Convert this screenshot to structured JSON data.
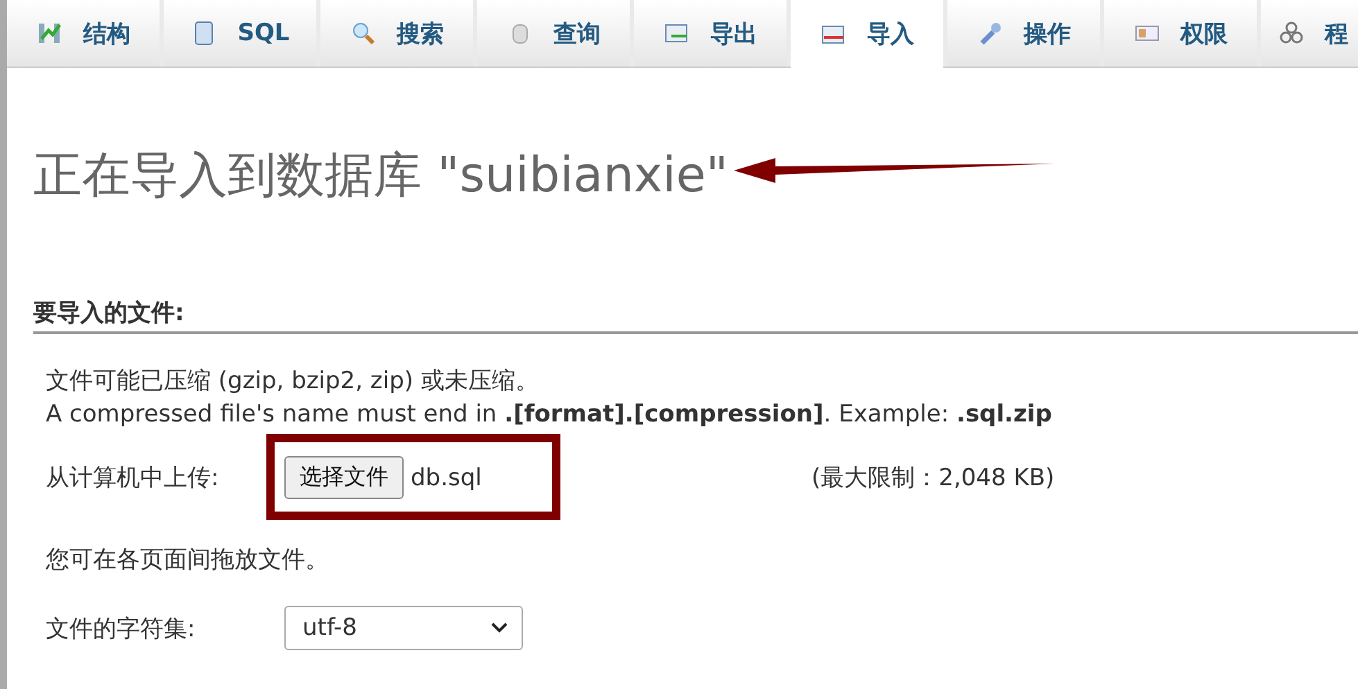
{
  "tabs": [
    {
      "label": "结构",
      "kind": "structure",
      "selected": false
    },
    {
      "label": "SQL",
      "kind": "sql",
      "selected": false
    },
    {
      "label": "搜索",
      "kind": "search",
      "selected": false
    },
    {
      "label": "查询",
      "kind": "query",
      "selected": false
    },
    {
      "label": "导出",
      "kind": "export",
      "selected": false
    },
    {
      "label": "导入",
      "kind": "import",
      "selected": true
    },
    {
      "label": "操作",
      "kind": "operations",
      "selected": false
    },
    {
      "label": "权限",
      "kind": "privileges",
      "selected": false
    },
    {
      "label": "程",
      "kind": "routines",
      "selected": false
    }
  ],
  "heading": "正在导入到数据库 \"suibianxie\"",
  "section": {
    "legend": "要导入的文件:",
    "note_lines": [
      "文件可能已压缩 (gzip, bzip2, zip) 或未压缩。",
      "A compressed file's name must end in **.[format].[compression]**. Example: **.sql.zip**"
    ],
    "upload_label": "从计算机中上传:",
    "choose_button": "选择文件",
    "file_name": "db.sql",
    "max_size": "(最大限制：2,048 KB)",
    "drag_hint": "您可在各页面间拖放文件。",
    "charset_label": "文件的字符集:",
    "charset_value": "utf-8"
  }
}
